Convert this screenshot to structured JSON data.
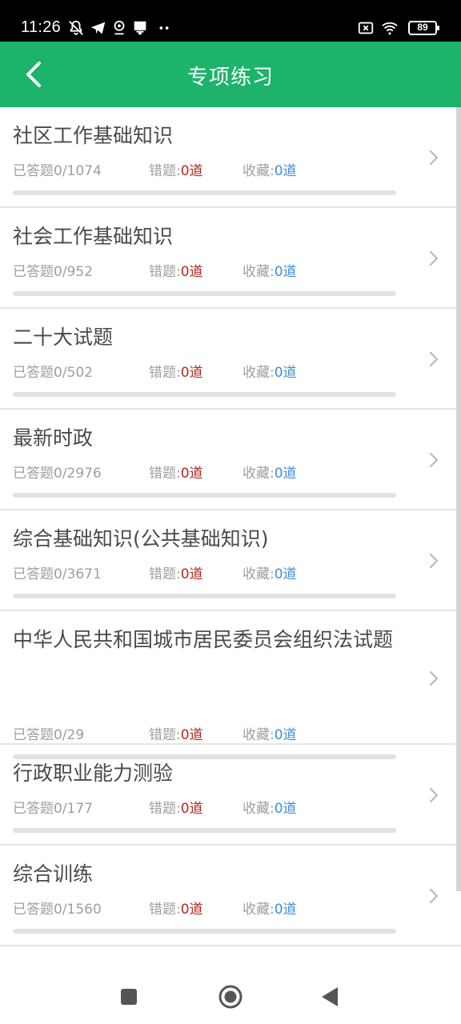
{
  "status_bar": {
    "time": "11:26",
    "left_icons": [
      "muted-bell-icon",
      "telegram-icon",
      "location-pin-icon",
      "notification-icon",
      "more-dots-icon"
    ],
    "right_icons": [
      "no-sim-icon",
      "wifi-icon",
      "battery-icon"
    ],
    "battery_level": "89"
  },
  "app_bar": {
    "title": "专项练习",
    "back_icon": "chevron-left-icon",
    "background": "#1db36b"
  },
  "labels": {
    "answered_prefix": "已答题",
    "wrong_prefix": "错题:",
    "fav_prefix": "收藏:"
  },
  "items": [
    {
      "title": "社区工作基础知识",
      "answered": "0/1074",
      "wrong": "0道",
      "fav": "0道",
      "progress": 0
    },
    {
      "title": "社会工作基础知识",
      "answered": "0/952",
      "wrong": "0道",
      "fav": "0道",
      "progress": 0
    },
    {
      "title": "二十大试题",
      "answered": "0/502",
      "wrong": "0道",
      "fav": "0道",
      "progress": 0
    },
    {
      "title": "最新时政",
      "answered": "0/2976",
      "wrong": "0道",
      "fav": "0道",
      "progress": 0
    },
    {
      "title": "综合基础知识(公共基础知识)",
      "answered": "0/3671",
      "wrong": "0道",
      "fav": "0道",
      "progress": 0
    },
    {
      "title": "中华人民共和国城市居民委员会组织法试题",
      "answered": "0/29",
      "wrong": "0道",
      "fav": "0道",
      "progress": 0
    },
    {
      "title": "行政职业能力测验",
      "answered": "0/177",
      "wrong": "0道",
      "fav": "0道",
      "progress": 0
    },
    {
      "title": "综合训练",
      "answered": "0/1560",
      "wrong": "0道",
      "fav": "0道",
      "progress": 0
    },
    {
      "title": "",
      "answered": "",
      "wrong": "",
      "fav": "",
      "progress": 0
    }
  ],
  "colors": {
    "accent": "#1db36b",
    "wrong": "#b22a1f",
    "favorite": "#3f8fd6",
    "title_text": "#4a4a4a",
    "meta_text": "#9e9e9e"
  },
  "nav_bar": {
    "icons": [
      "recents-square-icon",
      "home-circle-icon",
      "back-triangle-icon"
    ]
  }
}
